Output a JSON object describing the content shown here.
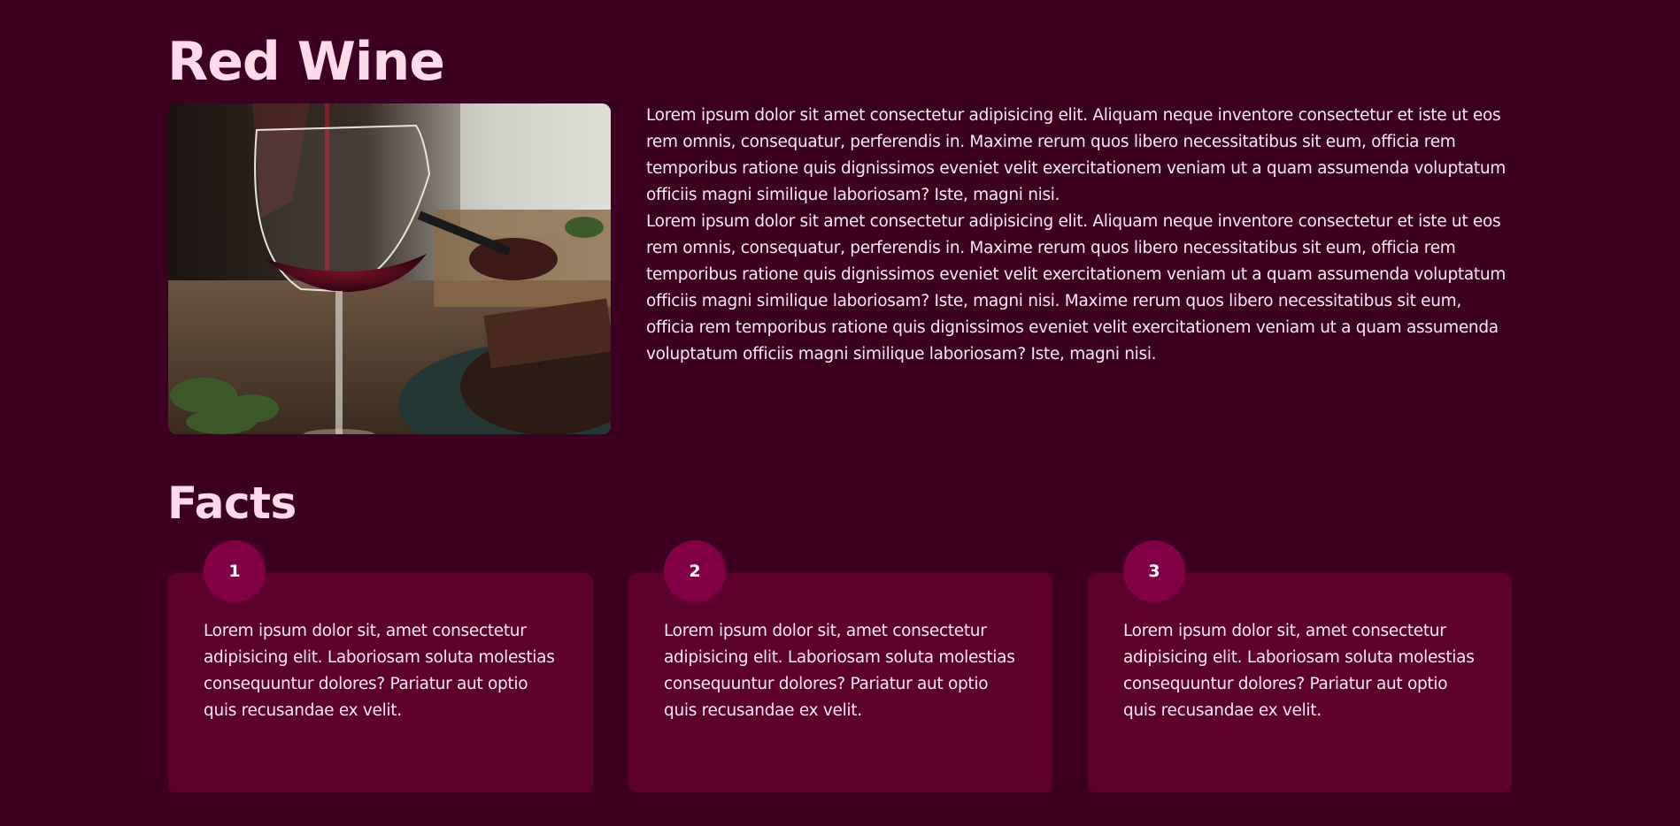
{
  "page": {
    "title": "Red Wine",
    "intro_paragraphs": [
      "Lorem ipsum dolor sit amet consectetur adipisicing elit. Aliquam neque inventore consectetur et iste ut eos rem omnis, consequatur, perferendis in. Maxime rerum quos libero necessitatibus sit eum, officia rem temporibus ratione quis dignissimos eveniet velit exercitationem veniam ut a quam assumenda voluptatum officiis magni similique laboriosam? Iste, magni nisi.",
      "Lorem ipsum dolor sit amet consectetur adipisicing elit. Aliquam neque inventore consectetur et iste ut eos rem omnis, consequatur, perferendis in. Maxime rerum quos libero necessitatibus sit eum, officia rem temporibus ratione quis dignissimos eveniet velit exercitationem veniam ut a quam assumenda voluptatum officiis magni similique laboriosam? Iste, magni nisi. Maxime rerum quos libero necessitatibus sit eum, officia rem temporibus ratione quis dignissimos eveniet velit exercitationem veniam ut a quam assumenda voluptatum officiis magni similique laboriosam? Iste, magni nisi."
    ]
  },
  "facts": {
    "title": "Facts",
    "cards": [
      {
        "number": "1",
        "text": "Lorem ipsum dolor sit, amet consectetur adipisicing elit. Laboriosam soluta molestias consequuntur dolores? Pariatur aut optio quis recusandae ex velit."
      },
      {
        "number": "2",
        "text": "Lorem ipsum dolor sit, amet consectetur adipisicing elit. Laboriosam soluta molestias consequuntur dolores? Pariatur aut optio quis recusandae ex velit."
      },
      {
        "number": "3",
        "text": "Lorem ipsum dolor sit, amet consectetur adipisicing elit. Laboriosam soluta molestias consequuntur dolores? Pariatur aut optio quis recusandae ex velit."
      }
    ]
  },
  "colors": {
    "background": "#3c0020",
    "heading": "#ffdaeb",
    "card": "#5c002c",
    "badge": "#820045",
    "text": "#fbe8f0"
  },
  "image": {
    "icon": "red-wine-glass-photo"
  }
}
